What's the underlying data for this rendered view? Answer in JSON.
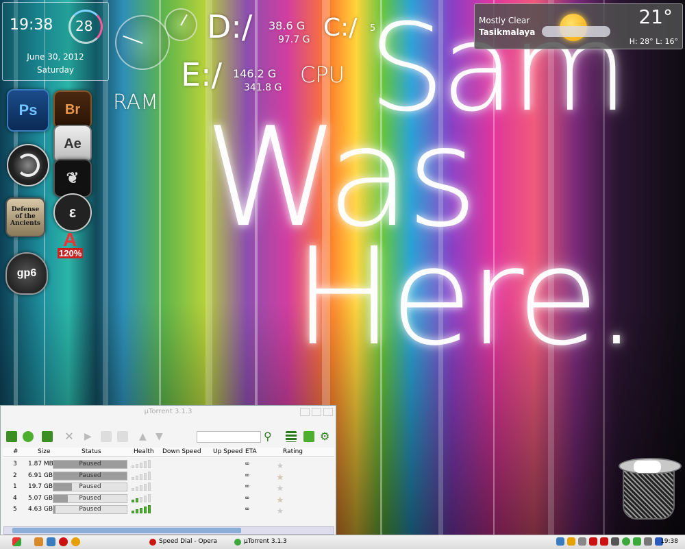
{
  "wallpaper": {
    "line1": "Sam",
    "line2": "Was",
    "line3": "Here."
  },
  "clock_gadget": {
    "time": "19:38",
    "seconds": "28",
    "date": "June 30, 2012",
    "day": "Saturday"
  },
  "system_meters": {
    "ram_label": "RAM",
    "cpu_label": "CPU",
    "drives": [
      {
        "label": "D:/",
        "free": "38.6 G",
        "total": "97.7 G"
      },
      {
        "label": "E:/",
        "free": "146.2 G",
        "total": "341.8 G"
      },
      {
        "label": "C:/",
        "free": "5"
      }
    ]
  },
  "weather": {
    "condition": "Mostly Clear",
    "city": "Tasikmalaya",
    "temperature": "21°",
    "high_low": "H: 28° L: 16°"
  },
  "dock": {
    "icons": [
      {
        "name": "photoshop-icon",
        "text": "Ps"
      },
      {
        "name": "bridge-icon",
        "text": "Br"
      },
      {
        "name": "after-effects-icon",
        "text": "Ae"
      },
      {
        "name": "dota-icon",
        "text": "Defense of the Ancients"
      },
      {
        "name": "daemon-tools-icon",
        "text": "120%"
      },
      {
        "name": "guitar-pro-icon",
        "text": "gp6"
      }
    ]
  },
  "utorrent": {
    "title": "µTorrent 3.1.3",
    "columns": [
      "#",
      "Size",
      "Status",
      "Health",
      "Down Speed",
      "Up Speed",
      "ETA",
      "Rating"
    ],
    "rows": [
      {
        "num": "3",
        "size": "1.87 MB",
        "status": "Paused",
        "progress": 1.0,
        "health": 0,
        "eta": "∞",
        "rating": 0
      },
      {
        "num": "2",
        "size": "6.91 GB",
        "status": "Paused",
        "progress": 1.0,
        "health": 0,
        "eta": "∞",
        "rating": 4
      },
      {
        "num": "1",
        "size": "19.7 GB",
        "status": "Paused",
        "progress": 0.25,
        "health": 0,
        "eta": "∞",
        "rating": 1
      },
      {
        "num": "4",
        "size": "5.07 GB",
        "status": "Paused",
        "progress": 0.2,
        "health": 2,
        "eta": "∞",
        "rating": 4
      },
      {
        "num": "5",
        "size": "4.63 GB",
        "status": "Paused",
        "progress": 0.03,
        "health": 5,
        "eta": "∞",
        "rating": 0
      }
    ]
  },
  "taskbar": {
    "tasks": [
      {
        "label": "Speed Dial - Opera",
        "color": "#cc1111"
      },
      {
        "label": "µTorrent 3.1.3",
        "color": "#3aa83a"
      }
    ],
    "clock": "19:38"
  },
  "colors": {
    "accent_green": "#4caf2e",
    "star": "#f2a000",
    "weather_panel": "#505050"
  }
}
